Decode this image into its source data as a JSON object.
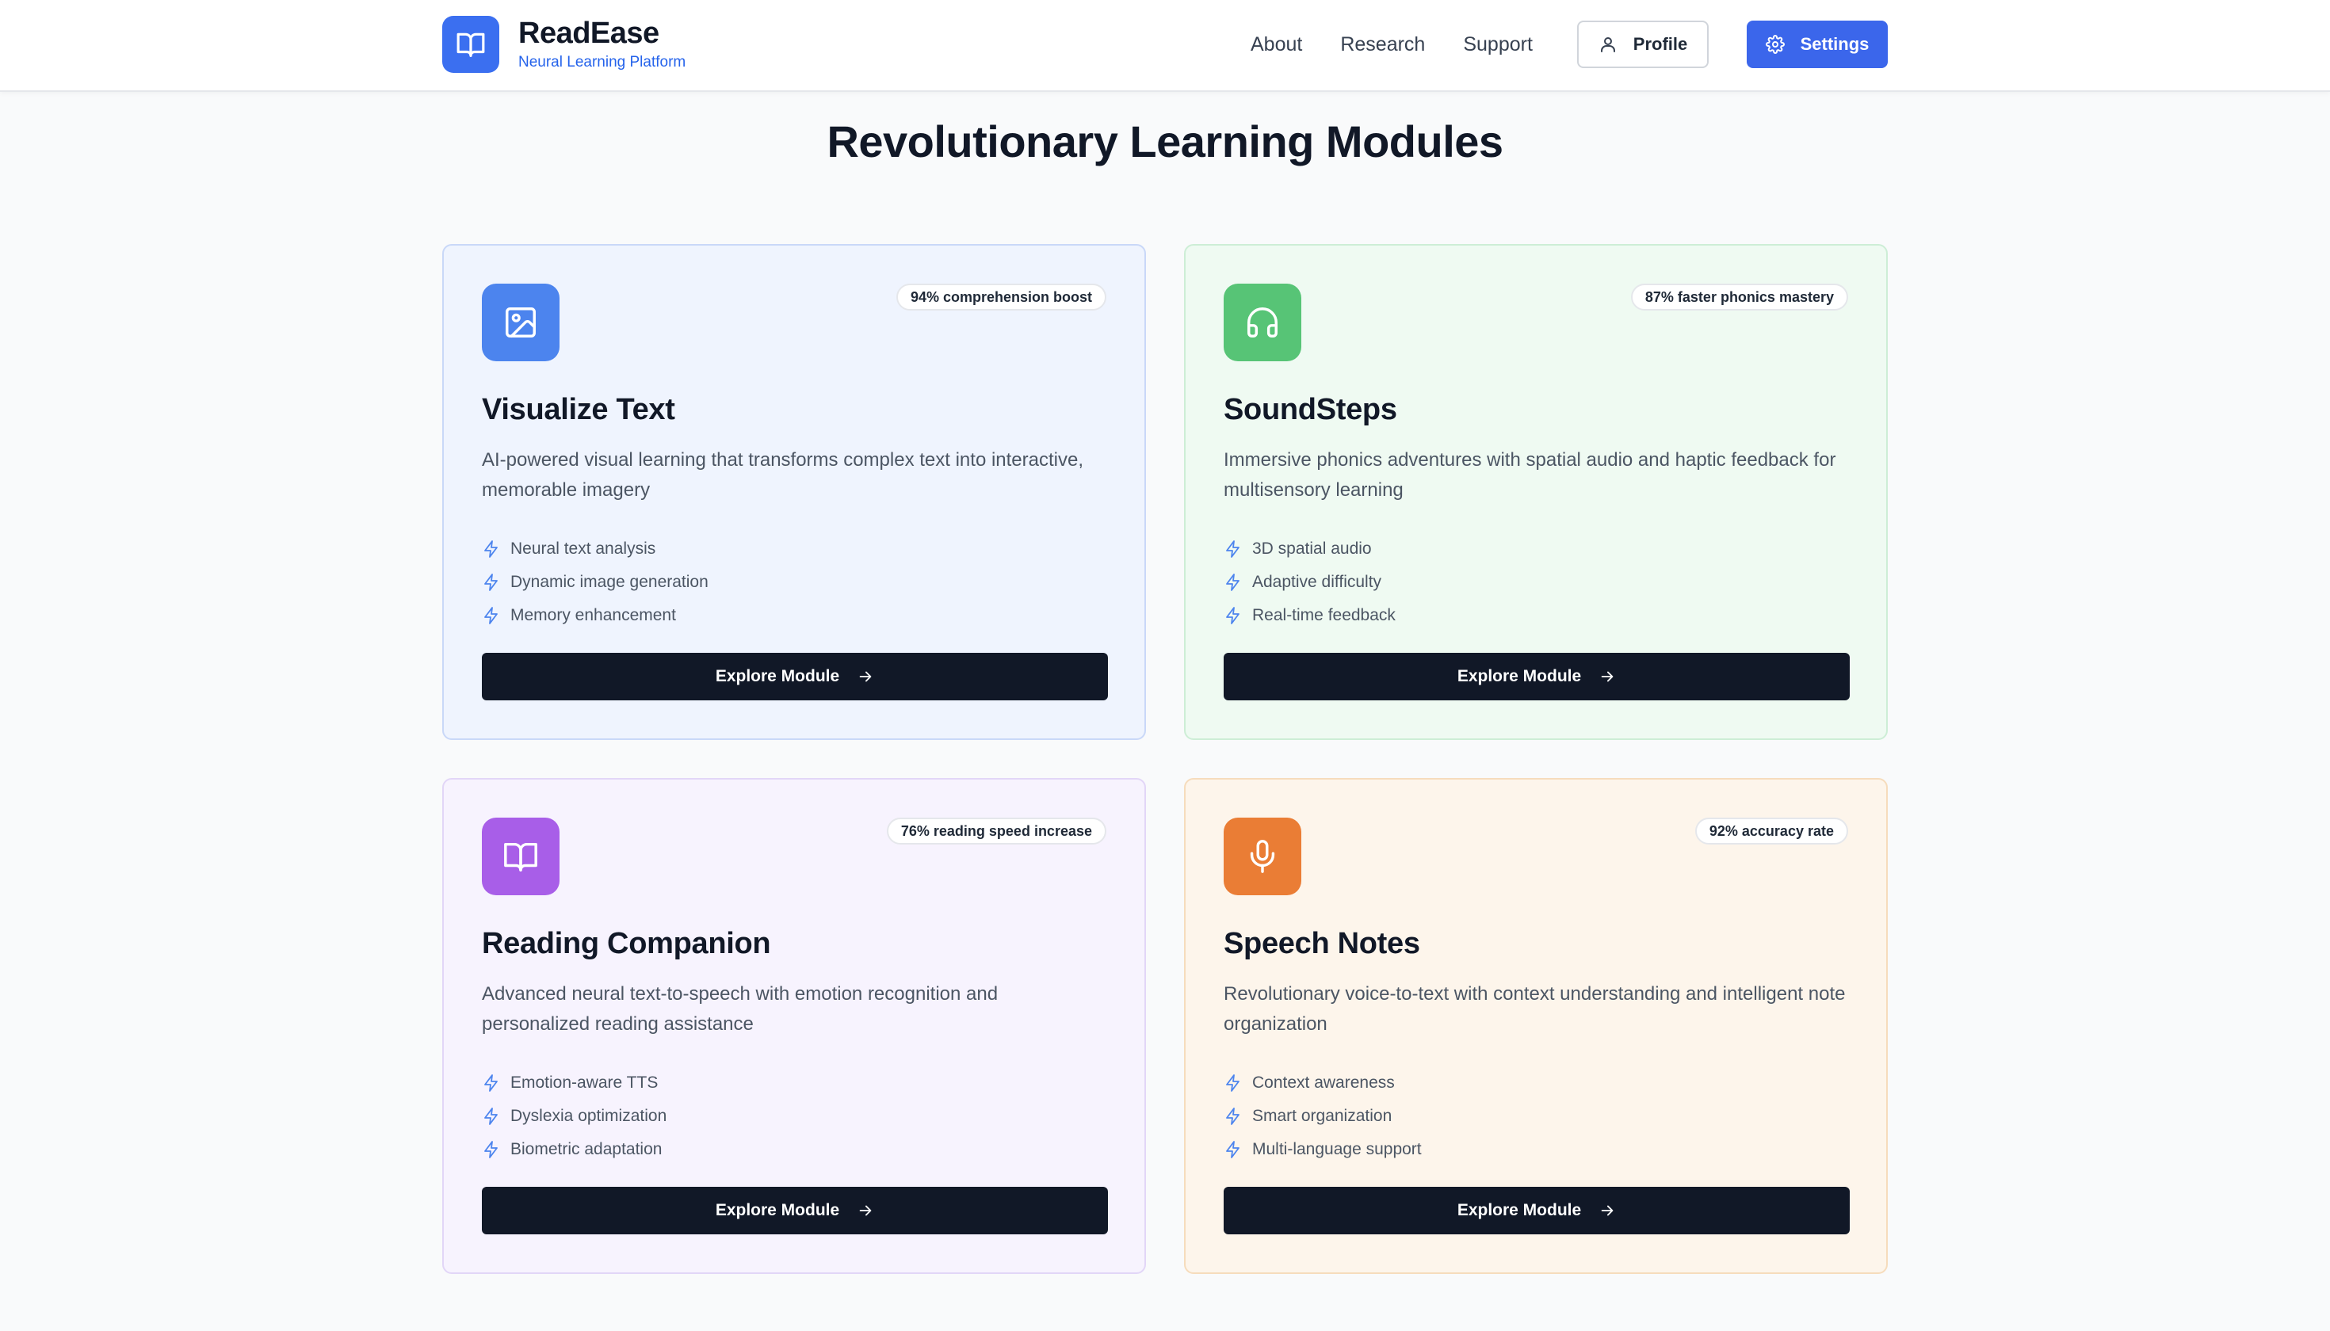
{
  "brand": {
    "name": "ReadEase",
    "tagline": "Neural Learning Platform",
    "logo_icon": "book-open-icon",
    "accent_color": "#3b6ff0"
  },
  "nav": {
    "links": [
      "About",
      "Research",
      "Support"
    ],
    "profile_label": "Profile",
    "profile_icon": "user-icon",
    "settings_label": "Settings",
    "settings_icon": "gear-icon"
  },
  "page": {
    "title": "Revolutionary Learning Modules"
  },
  "modules": [
    {
      "title": "Visualize Text",
      "badge": "94% comprehension boost",
      "description": "AI-powered visual learning that transforms complex text into interactive, memorable imagery",
      "icon": "image-icon",
      "color": "#4c84ee",
      "features": [
        "Neural text analysis",
        "Dynamic image generation",
        "Memory enhancement"
      ],
      "button_label": "Explore Module"
    },
    {
      "title": "SoundSteps",
      "badge": "87% faster phonics mastery",
      "description": "Immersive phonics adventures with spatial audio and haptic feedback for multisensory learning",
      "icon": "headphones-icon",
      "color": "#57c476",
      "features": [
        "3D spatial audio",
        "Adaptive difficulty",
        "Real-time feedback"
      ],
      "button_label": "Explore Module"
    },
    {
      "title": "Reading Companion",
      "badge": "76% reading speed increase",
      "description": "Advanced neural text-to-speech with emotion recognition and personalized reading assistance",
      "icon": "book-open-icon",
      "color": "#a85ee8",
      "features": [
        "Emotion-aware TTS",
        "Dyslexia optimization",
        "Biometric adaptation"
      ],
      "button_label": "Explore Module"
    },
    {
      "title": "Speech Notes",
      "badge": "92% accuracy rate",
      "description": "Revolutionary voice-to-text with context understanding and intelligent note organization",
      "icon": "microphone-icon",
      "color": "#ea7d35",
      "features": [
        "Context awareness",
        "Smart organization",
        "Multi-language support"
      ],
      "button_label": "Explore Module"
    }
  ]
}
